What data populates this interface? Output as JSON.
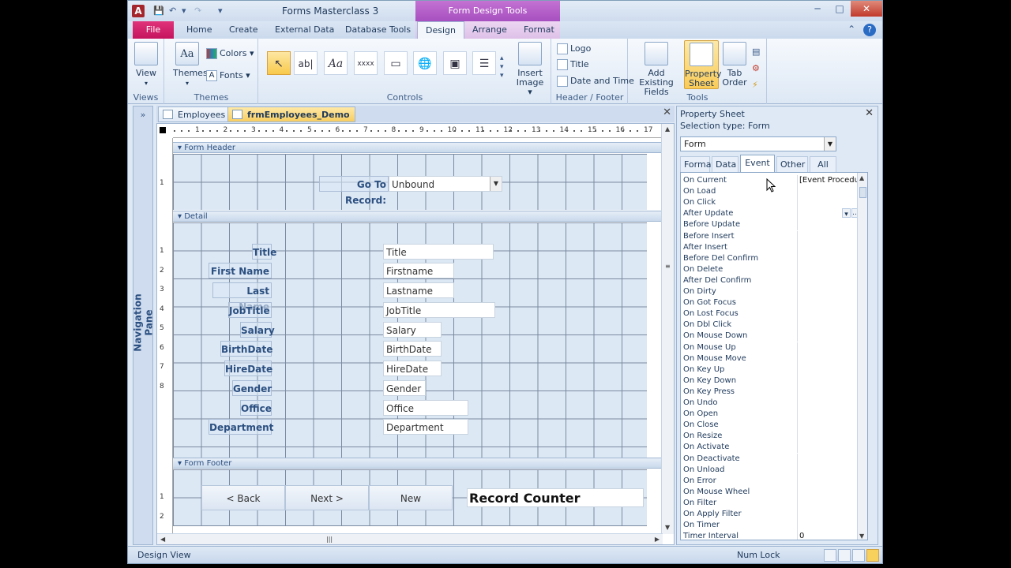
{
  "window": {
    "title": "Forms Masterclass 3",
    "context_title": "Form Design Tools",
    "app_icon": "A",
    "controls": {
      "minimize": "─",
      "maximize": "□",
      "close": "✕"
    }
  },
  "ribbon": {
    "tabs": [
      "File",
      "Home",
      "Create",
      "External Data",
      "Database Tools",
      "Design",
      "Arrange",
      "Format"
    ],
    "active_tab": "Design",
    "groups": {
      "views": {
        "label": "Views",
        "view": "View"
      },
      "themes": {
        "label": "Themes",
        "themes": "Themes",
        "colors": "Colors",
        "fonts": "Fonts"
      },
      "controls": {
        "label": "Controls",
        "insert_image": "Insert Image"
      },
      "header_footer": {
        "label": "Header / Footer",
        "logo": "Logo",
        "title": "Title",
        "date_time": "Date and Time"
      },
      "tools": {
        "label": "Tools",
        "add_fields": "Add Existing Fields",
        "property_sheet": "Property Sheet",
        "tab_order": "Tab Order"
      }
    }
  },
  "nav_pane": {
    "label": "Navigation Pane",
    "chevron": "»"
  },
  "doc_tabs": [
    {
      "label": "Employees"
    },
    {
      "label": "frmEmployees_Demo"
    }
  ],
  "form": {
    "sections": {
      "header": "Form Header",
      "detail": "Detail",
      "footer": "Form Footer"
    },
    "header_label": "Go To Record:",
    "header_combo": "Unbound",
    "fields": [
      {
        "label": "Title",
        "value": "Title"
      },
      {
        "label": "First Name",
        "value": "Firstname"
      },
      {
        "label": "Last Name",
        "value": "Lastname"
      },
      {
        "label": "JobTitle",
        "value": "JobTitle"
      },
      {
        "label": "Salary",
        "value": "Salary"
      },
      {
        "label": "BirthDate",
        "value": "BirthDate"
      },
      {
        "label": "HireDate",
        "value": "HireDate"
      },
      {
        "label": "Gender",
        "value": "Gender"
      },
      {
        "label": "Office",
        "value": "Office"
      },
      {
        "label": "Department",
        "value": "Department"
      }
    ],
    "footer_buttons": {
      "back": "< Back",
      "next": "Next >",
      "new": "New"
    },
    "record_counter": "Record Counter",
    "ruler_h": [
      "1",
      "2",
      "3",
      "4",
      "5",
      "6",
      "7",
      "8",
      "9",
      "10",
      "11",
      "12",
      "13",
      "14",
      "15",
      "16",
      "17"
    ],
    "ruler_v_header": [
      "1"
    ],
    "ruler_v_detail": [
      "1",
      "2",
      "3",
      "4",
      "5",
      "6",
      "7",
      "8"
    ],
    "ruler_v_footer": [
      "1",
      "2"
    ]
  },
  "property_sheet": {
    "title": "Property Sheet",
    "selection_type": "Selection type:  Form",
    "selected_object": "Form",
    "tabs": [
      "Format",
      "Data",
      "Event",
      "Other",
      "All"
    ],
    "active_tab": "Event",
    "rows": [
      {
        "name": "On Current",
        "value": "[Event Procedure]"
      },
      {
        "name": "On Load",
        "value": ""
      },
      {
        "name": "On Click",
        "value": ""
      },
      {
        "name": "After Update",
        "value": ""
      },
      {
        "name": "Before Update",
        "value": ""
      },
      {
        "name": "Before Insert",
        "value": ""
      },
      {
        "name": "After Insert",
        "value": ""
      },
      {
        "name": "Before Del Confirm",
        "value": ""
      },
      {
        "name": "On Delete",
        "value": ""
      },
      {
        "name": "After Del Confirm",
        "value": ""
      },
      {
        "name": "On Dirty",
        "value": ""
      },
      {
        "name": "On Got Focus",
        "value": ""
      },
      {
        "name": "On Lost Focus",
        "value": ""
      },
      {
        "name": "On Dbl Click",
        "value": ""
      },
      {
        "name": "On Mouse Down",
        "value": ""
      },
      {
        "name": "On Mouse Up",
        "value": ""
      },
      {
        "name": "On Mouse Move",
        "value": ""
      },
      {
        "name": "On Key Up",
        "value": ""
      },
      {
        "name": "On Key Down",
        "value": ""
      },
      {
        "name": "On Key Press",
        "value": ""
      },
      {
        "name": "On Undo",
        "value": ""
      },
      {
        "name": "On Open",
        "value": ""
      },
      {
        "name": "On Close",
        "value": ""
      },
      {
        "name": "On Resize",
        "value": ""
      },
      {
        "name": "On Activate",
        "value": ""
      },
      {
        "name": "On Deactivate",
        "value": ""
      },
      {
        "name": "On Unload",
        "value": ""
      },
      {
        "name": "On Error",
        "value": ""
      },
      {
        "name": "On Mouse Wheel",
        "value": ""
      },
      {
        "name": "On Filter",
        "value": ""
      },
      {
        "name": "On Apply Filter",
        "value": ""
      },
      {
        "name": "On Timer",
        "value": ""
      },
      {
        "name": "Timer Interval",
        "value": "0"
      }
    ]
  },
  "status": {
    "left": "Design View",
    "num_lock": "Num Lock"
  }
}
